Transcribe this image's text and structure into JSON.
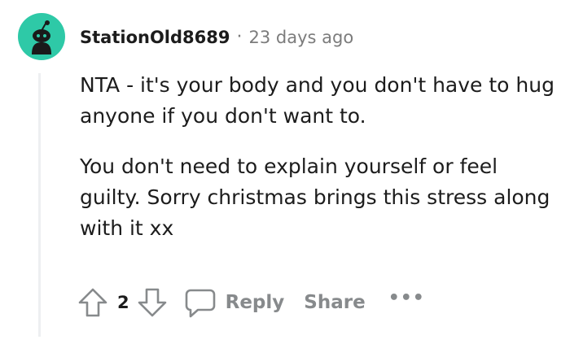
{
  "comment": {
    "username": "StationOld8689",
    "separator": "·",
    "timestamp": "23 days ago",
    "paragraphs": [
      "NTA - it's your body and you don't have to hug anyone if you don't want to.",
      "You don't need to explain yourself or feel guilty. Sorry christmas brings this stress along with it xx"
    ],
    "score": "2",
    "actions": {
      "reply": "Reply",
      "share": "Share",
      "more": "•••"
    },
    "avatar_color": "#2ec9a7"
  }
}
